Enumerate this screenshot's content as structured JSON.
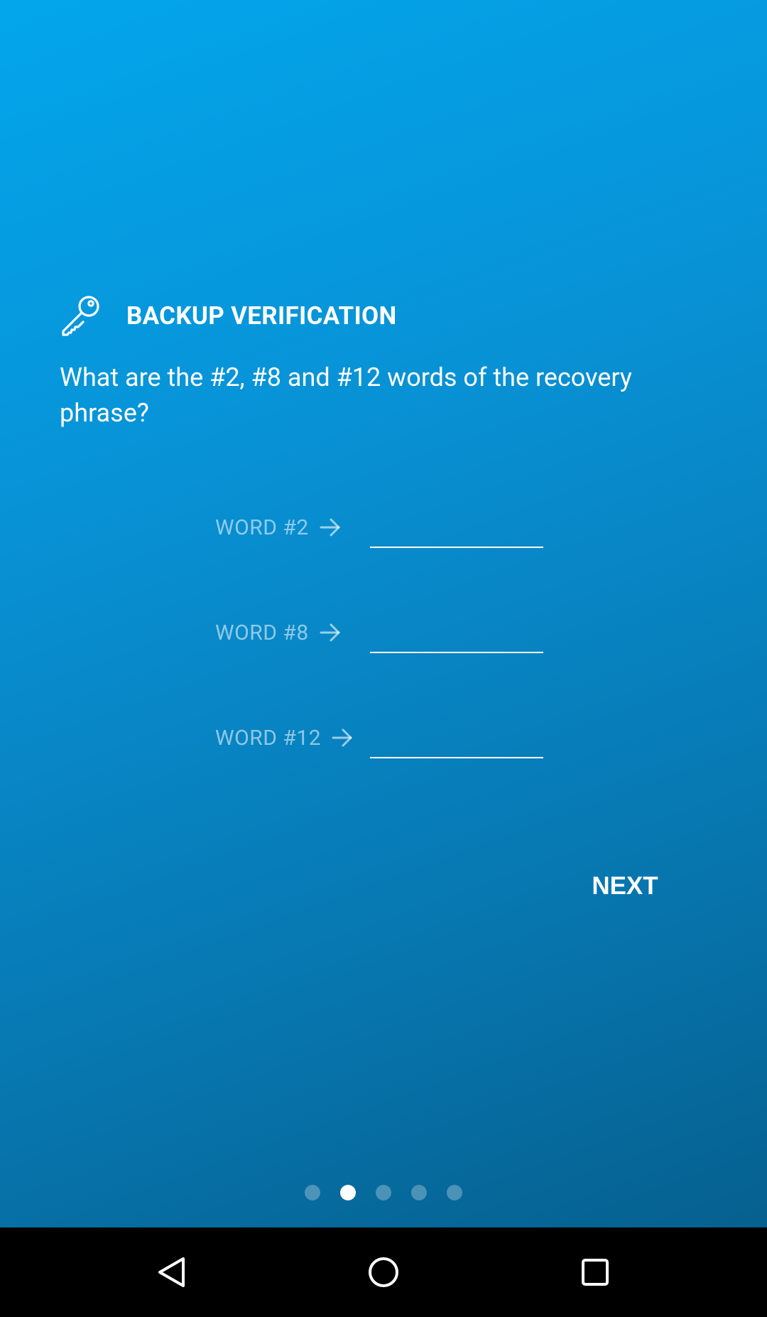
{
  "header": {
    "title": "BACKUP VERIFICATION",
    "icon": "key-icon"
  },
  "question": "What are the #2, #8 and #12 words of the recovery phrase?",
  "words": [
    {
      "label": "WORD #2",
      "value": ""
    },
    {
      "label": "WORD #8",
      "value": ""
    },
    {
      "label": "WORD #12",
      "value": ""
    }
  ],
  "next_label": "NEXT",
  "pagination": {
    "total": 5,
    "active_index": 1
  },
  "navbar": {
    "back_icon": "back-triangle-icon",
    "home_icon": "home-circle-icon",
    "recents_icon": "recents-square-icon"
  },
  "colors": {
    "gradient_start": "#03a6ec",
    "gradient_end": "#06608f",
    "text": "#ffffff",
    "navbar": "#000000"
  }
}
